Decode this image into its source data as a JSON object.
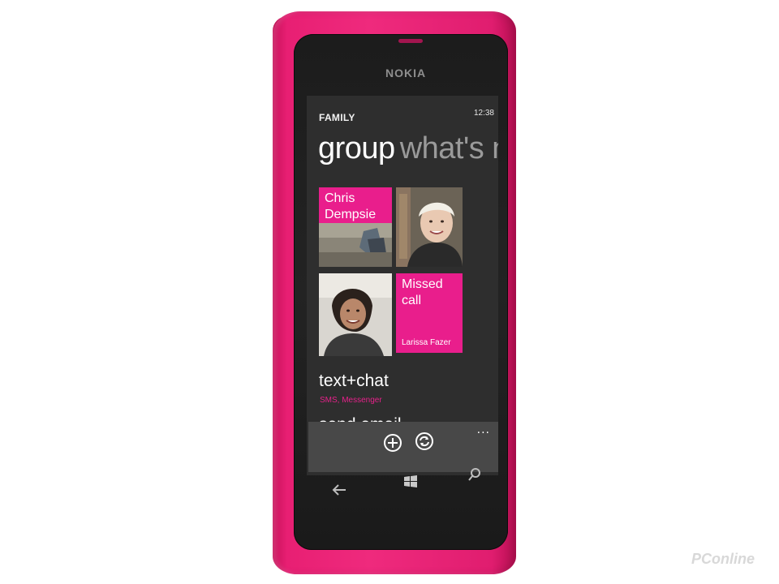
{
  "device": {
    "brand": "NOKIA",
    "body_color": "#e91e74",
    "accent": "#e6218a"
  },
  "screen": {
    "group_name": "FAMILY",
    "time": "12:38",
    "pivot": {
      "active": "group",
      "next": "what's ne"
    },
    "tiles": [
      {
        "title_line1": "Chris",
        "title_line2": "Dempsie"
      },
      {
        "title": "Missed call",
        "subtitle": "Larissa Fazer"
      }
    ],
    "links": [
      {
        "title": "text+chat",
        "subtitle": "SMS, Messenger"
      },
      {
        "title": "send email"
      }
    ],
    "app_bar": {
      "more": "...",
      "buttons": [
        "plus-icon",
        "sync-icon"
      ]
    }
  },
  "hardware_keys": [
    "back-icon",
    "windows-start-icon",
    "search-icon"
  ],
  "watermark": "PConline"
}
